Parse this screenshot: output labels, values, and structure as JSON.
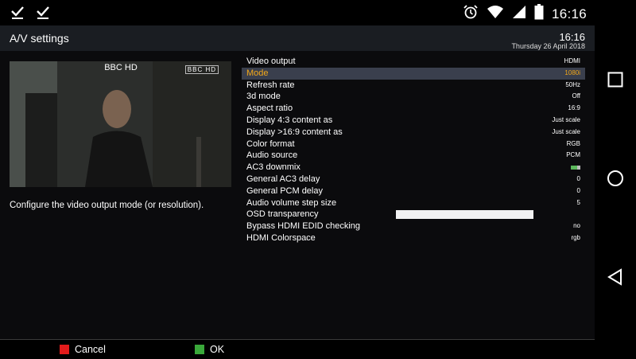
{
  "status_bar": {
    "left_icons": [
      "check-icon",
      "check-icon"
    ],
    "right_icons": [
      "alarm-icon",
      "wifi-icon",
      "signal-icon",
      "battery-icon"
    ],
    "clock": "16:16"
  },
  "header": {
    "title": "A/V settings",
    "time": "16:16",
    "date": "Thursday 26 April 2018"
  },
  "preview": {
    "channel": "BBC HD",
    "logo_text": "BBC HD"
  },
  "description": "Configure the video output mode (or resolution).",
  "settings": {
    "rows": [
      {
        "label": "Video output",
        "value": "HDMI"
      },
      {
        "label": "Mode",
        "value": "1080i"
      },
      {
        "label": "Refresh rate",
        "value": "50Hz"
      },
      {
        "label": "3d mode",
        "value": "Off"
      },
      {
        "label": "Aspect ratio",
        "value": "16:9"
      },
      {
        "label": "Display 4:3 content as",
        "value": "Just scale"
      },
      {
        "label": "Display >16:9 content as",
        "value": "Just scale"
      },
      {
        "label": "Color format",
        "value": "RGB"
      },
      {
        "label": "Audio source",
        "value": "PCM"
      },
      {
        "label": "AC3 downmix",
        "value": ""
      },
      {
        "label": "General AC3 delay",
        "value": "0"
      },
      {
        "label": "General PCM delay",
        "value": "0"
      },
      {
        "label": "Audio volume step size",
        "value": "5"
      },
      {
        "label": "OSD transparency",
        "value": ""
      },
      {
        "label": "Bypass HDMI EDID checking",
        "value": "no"
      },
      {
        "label": "HDMI Colorspace",
        "value": "rgb"
      }
    ],
    "selected_index": 1,
    "ac3_downmix_enabled": true,
    "osd_transparency_fraction": 0
  },
  "footer": {
    "cancel_label": "Cancel",
    "ok_label": "OK",
    "cancel_color": "#e31b1b",
    "ok_color": "#3aa83a"
  },
  "colors": {
    "selected_text": "#f3a81a",
    "selected_row_bg": "#3a3f4d",
    "header_bg": "#1a1d22"
  },
  "nav_bar": {
    "buttons": [
      "recents-icon",
      "home-icon",
      "back-icon"
    ]
  }
}
